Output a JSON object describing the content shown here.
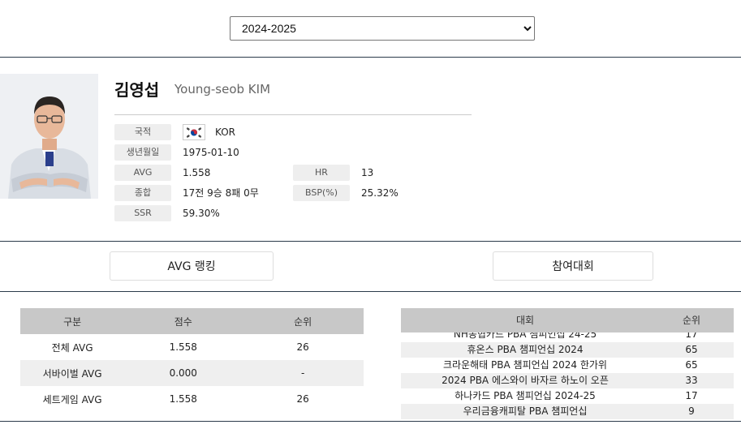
{
  "season": {
    "selected": "2024-2025"
  },
  "player": {
    "name_ko": "김영섭",
    "name_en": "Young-seob KIM",
    "nationality_label": "국적",
    "nationality": "KOR",
    "birth_label": "생년월일",
    "birth": "1975-01-10",
    "avg_label": "AVG",
    "avg": "1.558",
    "hr_label": "HR",
    "hr": "13",
    "record_label": "종합",
    "record": "17전 9승 8패 0무",
    "bsp_label": "BSP(%)",
    "bsp": "25.32%",
    "ssr_label": "SSR",
    "ssr": "59.30%"
  },
  "buttons": {
    "avg_ranking": "AVG 랭킹",
    "tournaments": "참여대회"
  },
  "avg_table": {
    "headers": [
      "구분",
      "점수",
      "순위"
    ],
    "rows": [
      {
        "type": "전체 AVG",
        "score": "1.558",
        "rank": "26"
      },
      {
        "type": "서바이벌 AVG",
        "score": "0.000",
        "rank": "-"
      },
      {
        "type": "세트게임 AVG",
        "score": "1.558",
        "rank": "26"
      }
    ]
  },
  "tour_table": {
    "headers": [
      "대회",
      "순위"
    ],
    "rows": [
      {
        "name": "NH농협카드 PBA 챔피언십 24-25",
        "rank": "17"
      },
      {
        "name": "휴온스 PBA 챔피언십 2024",
        "rank": "65"
      },
      {
        "name": "크라운해태 PBA 챔피언십 2024 한가위",
        "rank": "65"
      },
      {
        "name": "2024 PBA 에스와이 바자르 하노이 오픈",
        "rank": "33"
      },
      {
        "name": "하나카드 PBA 챔피언십 2024-25",
        "rank": "17"
      },
      {
        "name": "우리금융캐피탈 PBA 챔피언십",
        "rank": "9"
      }
    ]
  },
  "colors": {
    "header_bg": "#c8c8c8",
    "divider": "#2b3a4a",
    "flag_red": "#cd2e3a",
    "flag_blue": "#0047a0"
  }
}
